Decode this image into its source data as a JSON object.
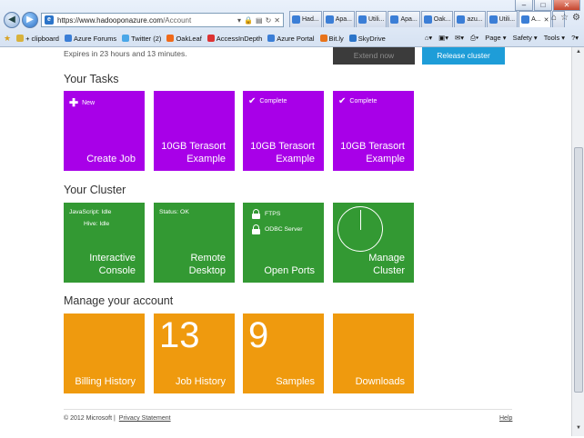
{
  "browser": {
    "window_controls": [
      "–",
      "□",
      "✕"
    ],
    "url_main": "https://www.hadooponazure.com",
    "url_path": "/Account",
    "tabs": [
      {
        "label": "Had..."
      },
      {
        "label": "Apa..."
      },
      {
        "label": "Utili..."
      },
      {
        "label": "Apa..."
      },
      {
        "label": "Oak..."
      },
      {
        "label": "azu..."
      },
      {
        "label": "Utili..."
      },
      {
        "label": "A..."
      }
    ],
    "favorites": [
      {
        "label": "+ clipboard",
        "color": "#d8b23c"
      },
      {
        "label": "Azure Forums",
        "color": "#3b7ed6"
      },
      {
        "label": "Twitter (2)",
        "color": "#4aa7e8"
      },
      {
        "label": "OakLeaf",
        "color": "#f06a1a"
      },
      {
        "label": "AccessInDepth",
        "color": "#d33"
      },
      {
        "label": "Azure Portal",
        "color": "#3b7ed6"
      },
      {
        "label": "Bit.ly",
        "color": "#e8731a"
      },
      {
        "label": "SkyDrive",
        "color": "#2b74c9"
      }
    ],
    "commands": [
      "Page ▾",
      "Safety ▾",
      "Tools ▾",
      "?▾"
    ]
  },
  "header": {
    "expires_text": "Expires in 23 hours and 13 minutes.",
    "extend_label": "Extend now",
    "release_label": "Release cluster"
  },
  "tasks": {
    "title": "Your Tasks",
    "tiles": [
      {
        "corner": "New",
        "label_1": "Create Job",
        "label_2": ""
      },
      {
        "corner": "",
        "label_1": "10GB Terasort",
        "label_2": "Example"
      },
      {
        "corner": "Complete",
        "label_1": "10GB Terasort",
        "label_2": "Example"
      },
      {
        "corner": "Complete",
        "label_1": "10GB Terasort",
        "label_2": "Example"
      }
    ]
  },
  "cluster": {
    "title": "Your Cluster",
    "console": {
      "status_1": "JavaScript: Idle",
      "status_2": "Hive: Idle",
      "label_1": "Interactive",
      "label_2": "Console"
    },
    "remote": {
      "status": "Status: OK",
      "label_1": "Remote",
      "label_2": "Desktop"
    },
    "ports": {
      "port_1": "FTPS",
      "port_2": "ODBC Server",
      "label": "Open Ports"
    },
    "manage": {
      "label_1": "Manage",
      "label_2": "Cluster"
    }
  },
  "account": {
    "title": "Manage your account",
    "tiles": [
      {
        "number": "",
        "label": "Billing History"
      },
      {
        "number": "13",
        "label": "Job History"
      },
      {
        "number": "9",
        "label": "Samples"
      },
      {
        "number": "",
        "label": "Downloads"
      }
    ]
  },
  "footer": {
    "copyright": "© 2012 Microsoft |",
    "privacy": "Privacy Statement",
    "help": "Help"
  }
}
